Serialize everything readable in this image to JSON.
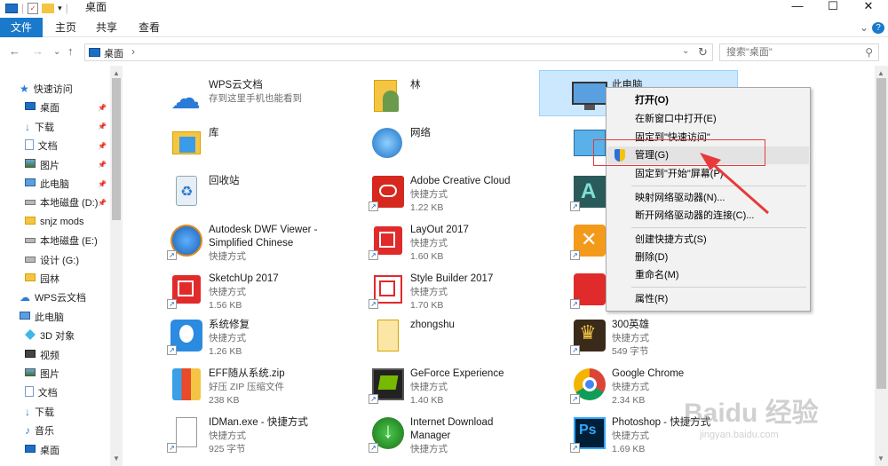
{
  "window": {
    "title": "桌面",
    "min": "—",
    "max": "☐",
    "close": "✕"
  },
  "ribbon": {
    "tabs": [
      "文件",
      "主页",
      "共享",
      "查看"
    ],
    "help": "?",
    "expand": "⌄"
  },
  "nav": {
    "back": "←",
    "forward": "→",
    "up_recent": "⌄",
    "up": "↑",
    "address": "桌面",
    "sep": "›",
    "refresh": "↻",
    "search_placeholder": "搜索\"桌面\""
  },
  "sidebar": {
    "items": [
      {
        "label": "快速访问",
        "icon": "star-icon",
        "pin": false,
        "level": 0
      },
      {
        "label": "桌面",
        "icon": "desktop-icon",
        "pin": true,
        "level": 1
      },
      {
        "label": "下载",
        "icon": "download-icon",
        "pin": true,
        "level": 1
      },
      {
        "label": "文档",
        "icon": "document-icon",
        "pin": true,
        "level": 1
      },
      {
        "label": "图片",
        "icon": "picture-icon",
        "pin": true,
        "level": 1
      },
      {
        "label": "此电脑",
        "icon": "computer-icon",
        "pin": true,
        "level": 1
      },
      {
        "label": "本地磁盘 (D:)",
        "icon": "drive-icon",
        "pin": true,
        "level": 1
      },
      {
        "label": "snjz mods",
        "icon": "folder-icon",
        "pin": false,
        "level": 1
      },
      {
        "label": "本地磁盘 (E:)",
        "icon": "drive-icon",
        "pin": false,
        "level": 1
      },
      {
        "label": "设计 (G:)",
        "icon": "drive-icon",
        "pin": false,
        "level": 1
      },
      {
        "label": "园林",
        "icon": "folder-icon",
        "pin": false,
        "level": 1
      },
      {
        "label": "WPS云文档",
        "icon": "cloud-icon",
        "pin": false,
        "level": 0
      },
      {
        "label": "此电脑",
        "icon": "computer-icon",
        "pin": false,
        "level": 0
      },
      {
        "label": "3D 对象",
        "icon": "3d-icon",
        "pin": false,
        "level": 1
      },
      {
        "label": "视频",
        "icon": "video-icon",
        "pin": false,
        "level": 1
      },
      {
        "label": "图片",
        "icon": "picture-icon",
        "pin": false,
        "level": 1
      },
      {
        "label": "文档",
        "icon": "document-icon",
        "pin": false,
        "level": 1
      },
      {
        "label": "下载",
        "icon": "download-icon",
        "pin": false,
        "level": 1
      },
      {
        "label": "音乐",
        "icon": "music-icon",
        "pin": false,
        "level": 1
      },
      {
        "label": "桌面",
        "icon": "desktop-icon",
        "pin": false,
        "level": 1
      }
    ]
  },
  "files": {
    "col1": [
      {
        "name": "WPS云文档",
        "l2": "存到这里手机也能看到",
        "l3": "",
        "icon": "cloud-icon",
        "shortcut": false
      },
      {
        "name": "库",
        "l2": "",
        "l3": "",
        "icon": "library-icon",
        "shortcut": false
      },
      {
        "name": "回收站",
        "l2": "",
        "l3": "",
        "icon": "recycle-bin-icon",
        "shortcut": false
      },
      {
        "name": "Autodesk DWF Viewer -",
        "name2": "Simplified Chinese",
        "l2": "快捷方式",
        "l3": "",
        "icon": "globe-app-icon",
        "shortcut": true
      },
      {
        "name": "SketchUp 2017",
        "l2": "快捷方式",
        "l3": "1.56 KB",
        "icon": "sketchup-icon",
        "shortcut": true
      },
      {
        "name": "系统修复",
        "l2": "快捷方式",
        "l3": "1.26 KB",
        "icon": "repair-icon",
        "shortcut": true
      },
      {
        "name": "EFF随从系统.zip",
        "l2": "好压 ZIP 压缩文件",
        "l3": "238 KB",
        "icon": "zip-icon",
        "shortcut": false
      },
      {
        "name": "IDMan.exe - 快捷方式",
        "l2": "快捷方式",
        "l3": "925 字节",
        "icon": "blank-file-icon",
        "shortcut": true
      }
    ],
    "col2": [
      {
        "name": "林",
        "l2": "",
        "l3": "",
        "icon": "user-folder-icon",
        "shortcut": false
      },
      {
        "name": "网络",
        "l2": "",
        "l3": "",
        "icon": "network-icon",
        "shortcut": false
      },
      {
        "name": "Adobe Creative Cloud",
        "l2": "快捷方式",
        "l3": "1.22 KB",
        "icon": "adobe-cc-icon",
        "shortcut": true
      },
      {
        "name": "LayOut 2017",
        "l2": "快捷方式",
        "l3": "1.60 KB",
        "icon": "layout-icon",
        "shortcut": true
      },
      {
        "name": "Style Builder 2017",
        "l2": "快捷方式",
        "l3": "1.70 KB",
        "icon": "style-builder-icon",
        "shortcut": true
      },
      {
        "name": "zhongshu",
        "l2": "",
        "l3": "",
        "icon": "folder-icon",
        "shortcut": false
      },
      {
        "name": "GeForce Experience",
        "l2": "快捷方式",
        "l3": "1.40 KB",
        "icon": "geforce-icon",
        "shortcut": true
      },
      {
        "name": "Internet Download",
        "name2": "Manager",
        "l2": "快捷方式",
        "l3": "",
        "icon": "idm-icon",
        "shortcut": true
      }
    ],
    "col3": [
      {
        "name": "此电脑",
        "l2": "",
        "l3": "",
        "icon": "computer-icon",
        "shortcut": false,
        "selected": true
      },
      {
        "name": "",
        "l2": "",
        "l3": "",
        "icon": "control-panel-icon",
        "shortcut": false
      },
      {
        "name": "",
        "l2": "",
        "l3": "",
        "icon": "autocad-icon",
        "shortcut": true
      },
      {
        "name": "",
        "l2": "",
        "l3": "",
        "icon": "game-icon",
        "shortcut": true
      },
      {
        "name": "",
        "l2": "",
        "l3": "",
        "icon": "game2-icon",
        "shortcut": true
      },
      {
        "name": "300英雄",
        "l2": "快捷方式",
        "l3": "549 字节",
        "icon": "hero-icon",
        "shortcut": true
      },
      {
        "name": "Google Chrome",
        "l2": "快捷方式",
        "l3": "2.34 KB",
        "icon": "chrome-icon",
        "shortcut": true
      },
      {
        "name": "Photoshop - 快捷方式",
        "l2": "快捷方式",
        "l3": "1.69 KB",
        "icon": "photoshop-icon",
        "shortcut": true
      }
    ]
  },
  "context_menu": {
    "items": [
      "打开(O)",
      "在新窗口中打开(E)",
      "固定到\"快速访问\"",
      "管理(G)",
      "固定到\"开始\"屏幕(P)",
      "映射网络驱动器(N)...",
      "断开网络驱动器的连接(C)...",
      "创建快捷方式(S)",
      "删除(D)",
      "重命名(M)",
      "属性(R)"
    ],
    "highlighted": "管理(G)"
  },
  "watermark": {
    "brand": "Baidu",
    "cn": "经验",
    "url": "jingyan.baidu.com"
  },
  "colors": {
    "accent": "#1979ca",
    "highlight": "#e83a3a",
    "selection": "#cce8ff"
  }
}
